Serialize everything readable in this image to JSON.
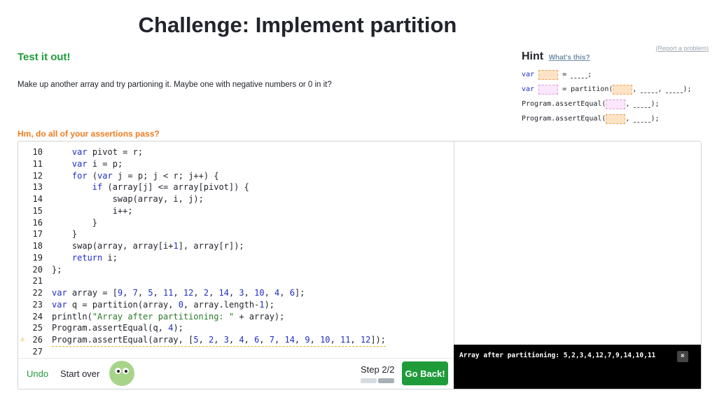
{
  "title": "Challenge: Implement partition",
  "test_heading": "Test it out!",
  "instructions": "Make up another array and try partioning it. Maybe one with negative numbers or 0 in it?",
  "assert_question": "Hm, do all of your assertions pass?",
  "report_link": "(Report a problem)",
  "hint": {
    "title": "Hint",
    "whats_this": "What's this?",
    "lines": [
      {
        "kw": "var",
        "pre": " ",
        "mid": " = ",
        "post": ";"
      },
      {
        "kw": "var",
        "pre": " ",
        "mid": " = partition(",
        "post": ");"
      },
      {
        "kw": "",
        "pre": "Program.assertEqual(",
        "mid": ", ",
        "post": ");"
      },
      {
        "kw": "",
        "pre": "Program.assertEqual(",
        "mid": ", ",
        "post": ");"
      }
    ]
  },
  "code_lines": [
    {
      "num": "10",
      "text": "    var pivot = r;"
    },
    {
      "num": "11",
      "text": "    var i = p;"
    },
    {
      "num": "12",
      "text": "    for (var j = p; j < r; j++) {"
    },
    {
      "num": "13",
      "text": "        if (array[j] <= array[pivot]) {"
    },
    {
      "num": "14",
      "text": "            swap(array, i, j);"
    },
    {
      "num": "15",
      "text": "            i++;"
    },
    {
      "num": "16",
      "text": "        }"
    },
    {
      "num": "17",
      "text": "    }"
    },
    {
      "num": "18",
      "text": "    swap(array, array[i+1], array[r]);"
    },
    {
      "num": "19",
      "text": "    return i;"
    },
    {
      "num": "20",
      "text": "};"
    },
    {
      "num": "21",
      "text": ""
    },
    {
      "num": "22",
      "text": "var array = [9, 7, 5, 11, 12, 2, 14, 3, 10, 4, 6];"
    },
    {
      "num": "23",
      "text": "var q = partition(array, 0, array.length-1);"
    },
    {
      "num": "24",
      "text": "println(\"Array after partitioning: \" + array);"
    },
    {
      "num": "25",
      "text": "Program.assertEqual(q, 4);"
    },
    {
      "num": "26",
      "text": "Program.assertEqual(array, [5, 2, 3, 4, 6, 7, 14, 9, 10, 11, 12]);"
    },
    {
      "num": "27",
      "text": ""
    }
  ],
  "console_output": "Array after partitioning: 5,2,3,4,12,7,9,14,10,11",
  "console_close": "✖",
  "footer": {
    "undo": "Undo",
    "start_over": "Start over",
    "step": "Step 2/2",
    "go_back": "Go Back!"
  },
  "colors": {
    "accent_green": "#1f9b3a",
    "warning_orange": "#f07c1f"
  }
}
